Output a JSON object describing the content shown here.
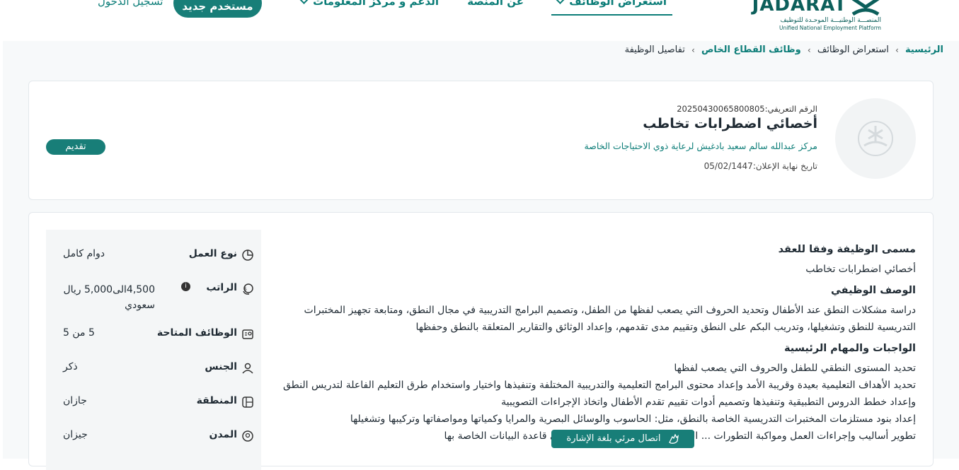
{
  "header": {
    "logo": {
      "word": "JADARAT",
      "ar_subtitle": "المنصـــة الوطنيـــة الموحـدة للتوظيف",
      "en_subtitle": "Unified National Employment Platform"
    },
    "nav": [
      {
        "label": "استعراض الوظائف",
        "active": true
      },
      {
        "label": "عن المنصة",
        "active": false
      },
      {
        "label": "الدعم و مركز المعلومات",
        "active": false
      }
    ],
    "register_label": "مستخدم جديد",
    "login_label": "تسجيل الدخول"
  },
  "breadcrumb": [
    {
      "label": "الرئيسية",
      "link": true
    },
    {
      "label": "استعراض الوظائف",
      "link": false
    },
    {
      "label": "وظائف القطاع الخاص",
      "link": true
    },
    {
      "label": "تفاصيل الوظيفة",
      "link": false
    }
  ],
  "job": {
    "id_text": "الرقم التعريفي:20250430065800805",
    "title": "أخصائي اضطرابات تخاطب",
    "employer": "مركز عبدالله سالم سعيد بادغيش لرعاية ذوي الاحتياجات الخاصة",
    "end_date_text": "تاريخ نهاية الإعلان:05/02/1447",
    "apply_label": "تقديم"
  },
  "facts": [
    {
      "label": "نوع العمل",
      "value": "دوام كامل",
      "icon": "pie-chart-icon"
    },
    {
      "label": "الراتب",
      "value": "4,500الى5,000 ريال سعودي",
      "icon": "money-icon",
      "info": "i"
    },
    {
      "label": "الوظائف المتاحة",
      "value": "5 من 5",
      "icon": "id-card-icon"
    },
    {
      "label": "الجنس",
      "value": "ذكر",
      "icon": "user-icon"
    },
    {
      "label": "المنطقة",
      "value": "جازان",
      "icon": "map-icon"
    },
    {
      "label": "المدن",
      "value": "جيزان",
      "icon": "location-pin-icon"
    }
  ],
  "description": {
    "h1": "مسمى الوظيفة وفقا للعقد",
    "p1": "أخصائي اضطرابات تخاطب",
    "h2": "الوصف الوظيفي",
    "p2": "دراسة مشكلات النطق عند الأطفال وتحديد الحروف التي يصعب لفظها من الطفل، وتصميم البرامج التدريبية في مجال النطق، ومتابعة تجهيز المختبرات التدريسية للنطق وتشغيلها، وتدريب البكم على النطق وتقييم مدى تقدمهم، وإعداد الوثائق والتقارير المتعلقة بالنطق وحفظها",
    "h3": "الواجبات والمهام الرئيسية",
    "duties": [
      "تحديد المستوى النطقي للطفل والحروف التي يصعب لفظها",
      "تحديد الأهداف التعليمية بعيدة وقريبة الأمد وإعداد محتوى البرامج التعليمية والتدريبية المختلفة وتنفيذها واختيار واستخدام طرق التعليم الفاعلة لتدريس النطق وإعداد خطط الدروس التطبيقية وتنفيذها وتصميم أدوات تقييم تقدم الأطفال واتخاذ الإجراءات التصويبية",
      "إعداد بنود مستلزمات المختبرات التدريسية الخاصة بالنطق، مثل: الحاسوب والوسائل البصرية والمرايا وكمياتها ومواصفاتها وتركيبها وتشغيلها",
      "تطوير أساليب وإجراءات العمل ومواكبة التطورات ... التقارير المتعلقة بالنطق وحفظها في قاعدة البيانات الخاصة بها"
    ]
  },
  "sign_banner_label": "اتصال مرئي بلغة الإشارة"
}
